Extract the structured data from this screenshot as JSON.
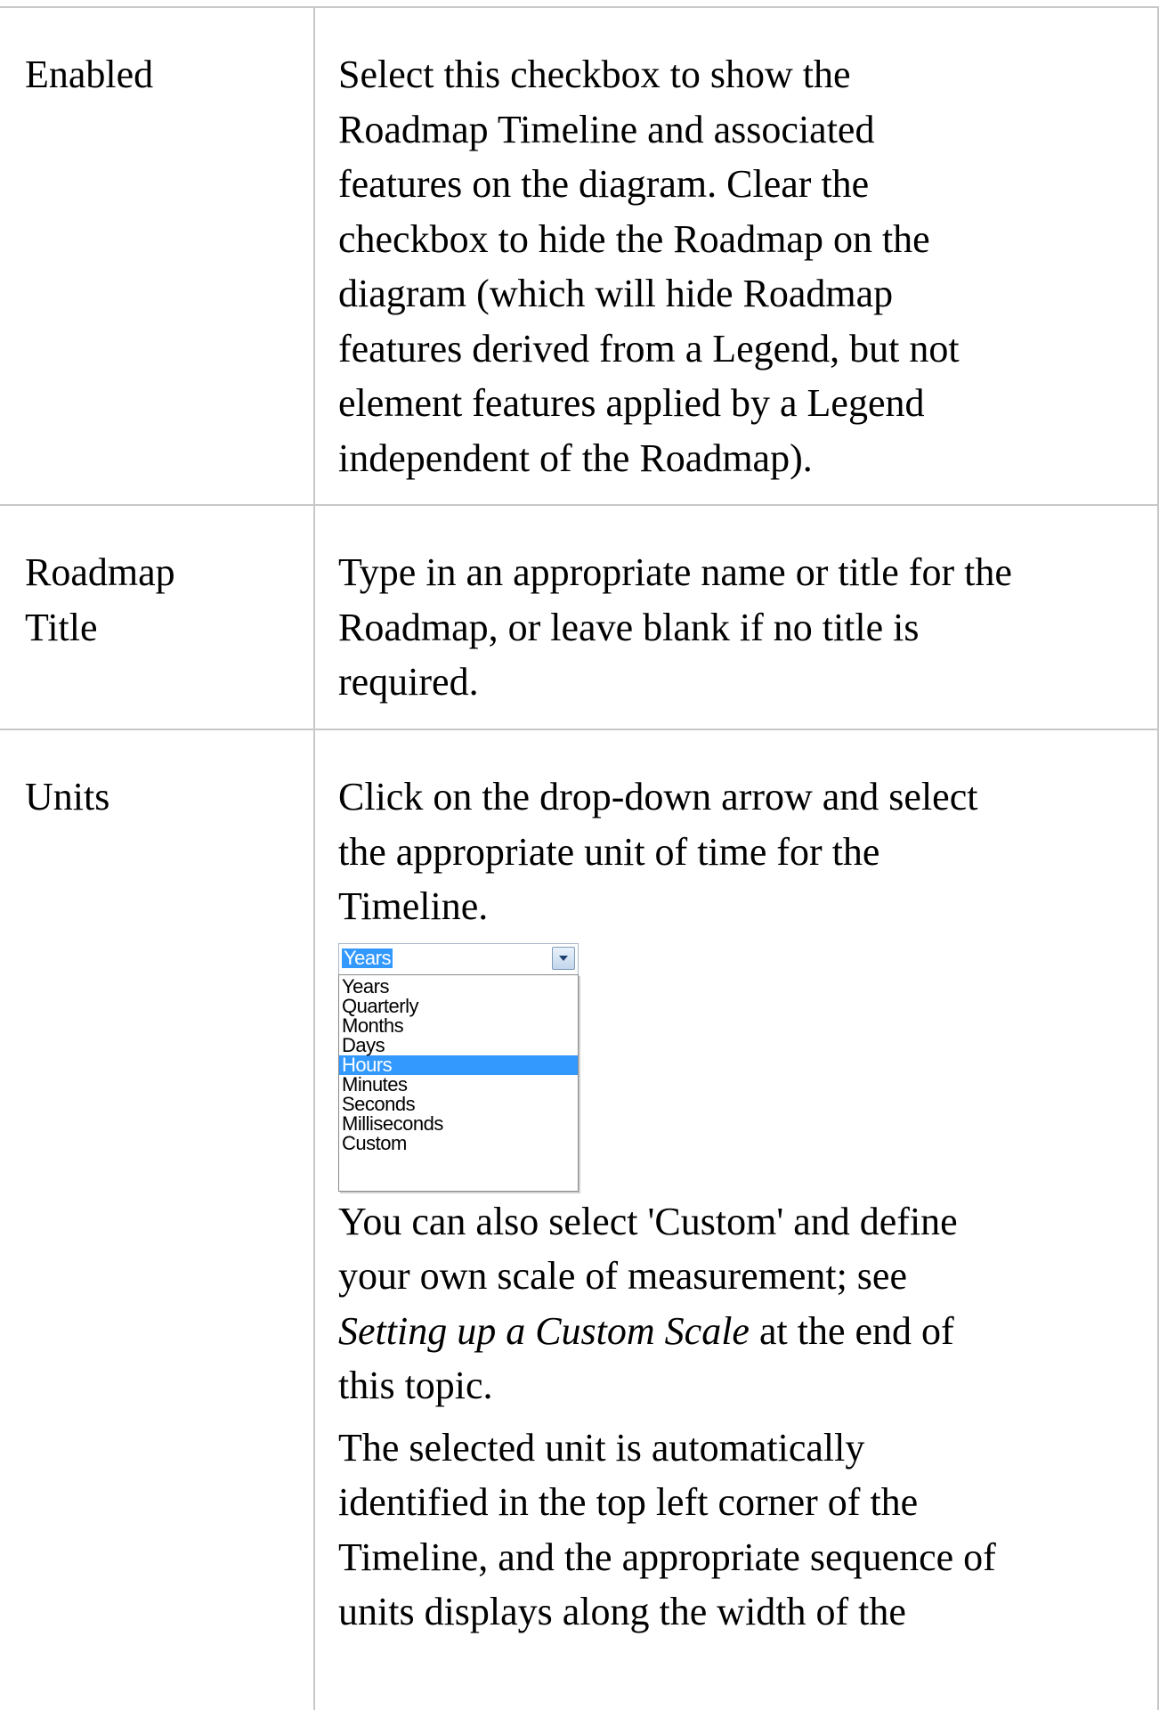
{
  "rows": [
    {
      "label": "Enabled",
      "text": "Select this checkbox to show the Roadmap Timeline and associated features on the diagram. Clear the checkbox to hide the Roadmap on the diagram (which will hide Roadmap features derived from a Legend, but not element features applied by a Legend independent of the Roadmap)."
    },
    {
      "label_line1": "Roadmap",
      "label_line2": "Title",
      "text": "Type in an appropriate name or title for the Roadmap, or leave blank if no title is required."
    },
    {
      "label": "Units",
      "intro": "Click on the drop-down arrow and select the appropriate unit of time for the Timeline.",
      "dropdown": {
        "selected_value": "Years",
        "options": [
          "Years",
          "Quarterly",
          "Months",
          "Days",
          "Hours",
          "Minutes",
          "Seconds",
          "Milliseconds",
          "Custom"
        ],
        "highlighted_option": "Hours"
      },
      "custom_pre": "You can also select 'Custom' and define your own scale of measurement; see ",
      "custom_link": "Setting up a Custom Scale",
      "custom_post": " at the end of this topic.",
      "selected_text": "The selected unit is automatically identified in the top left corner of the Timeline, and the appropriate sequence of units displays along the width of the"
    }
  ]
}
